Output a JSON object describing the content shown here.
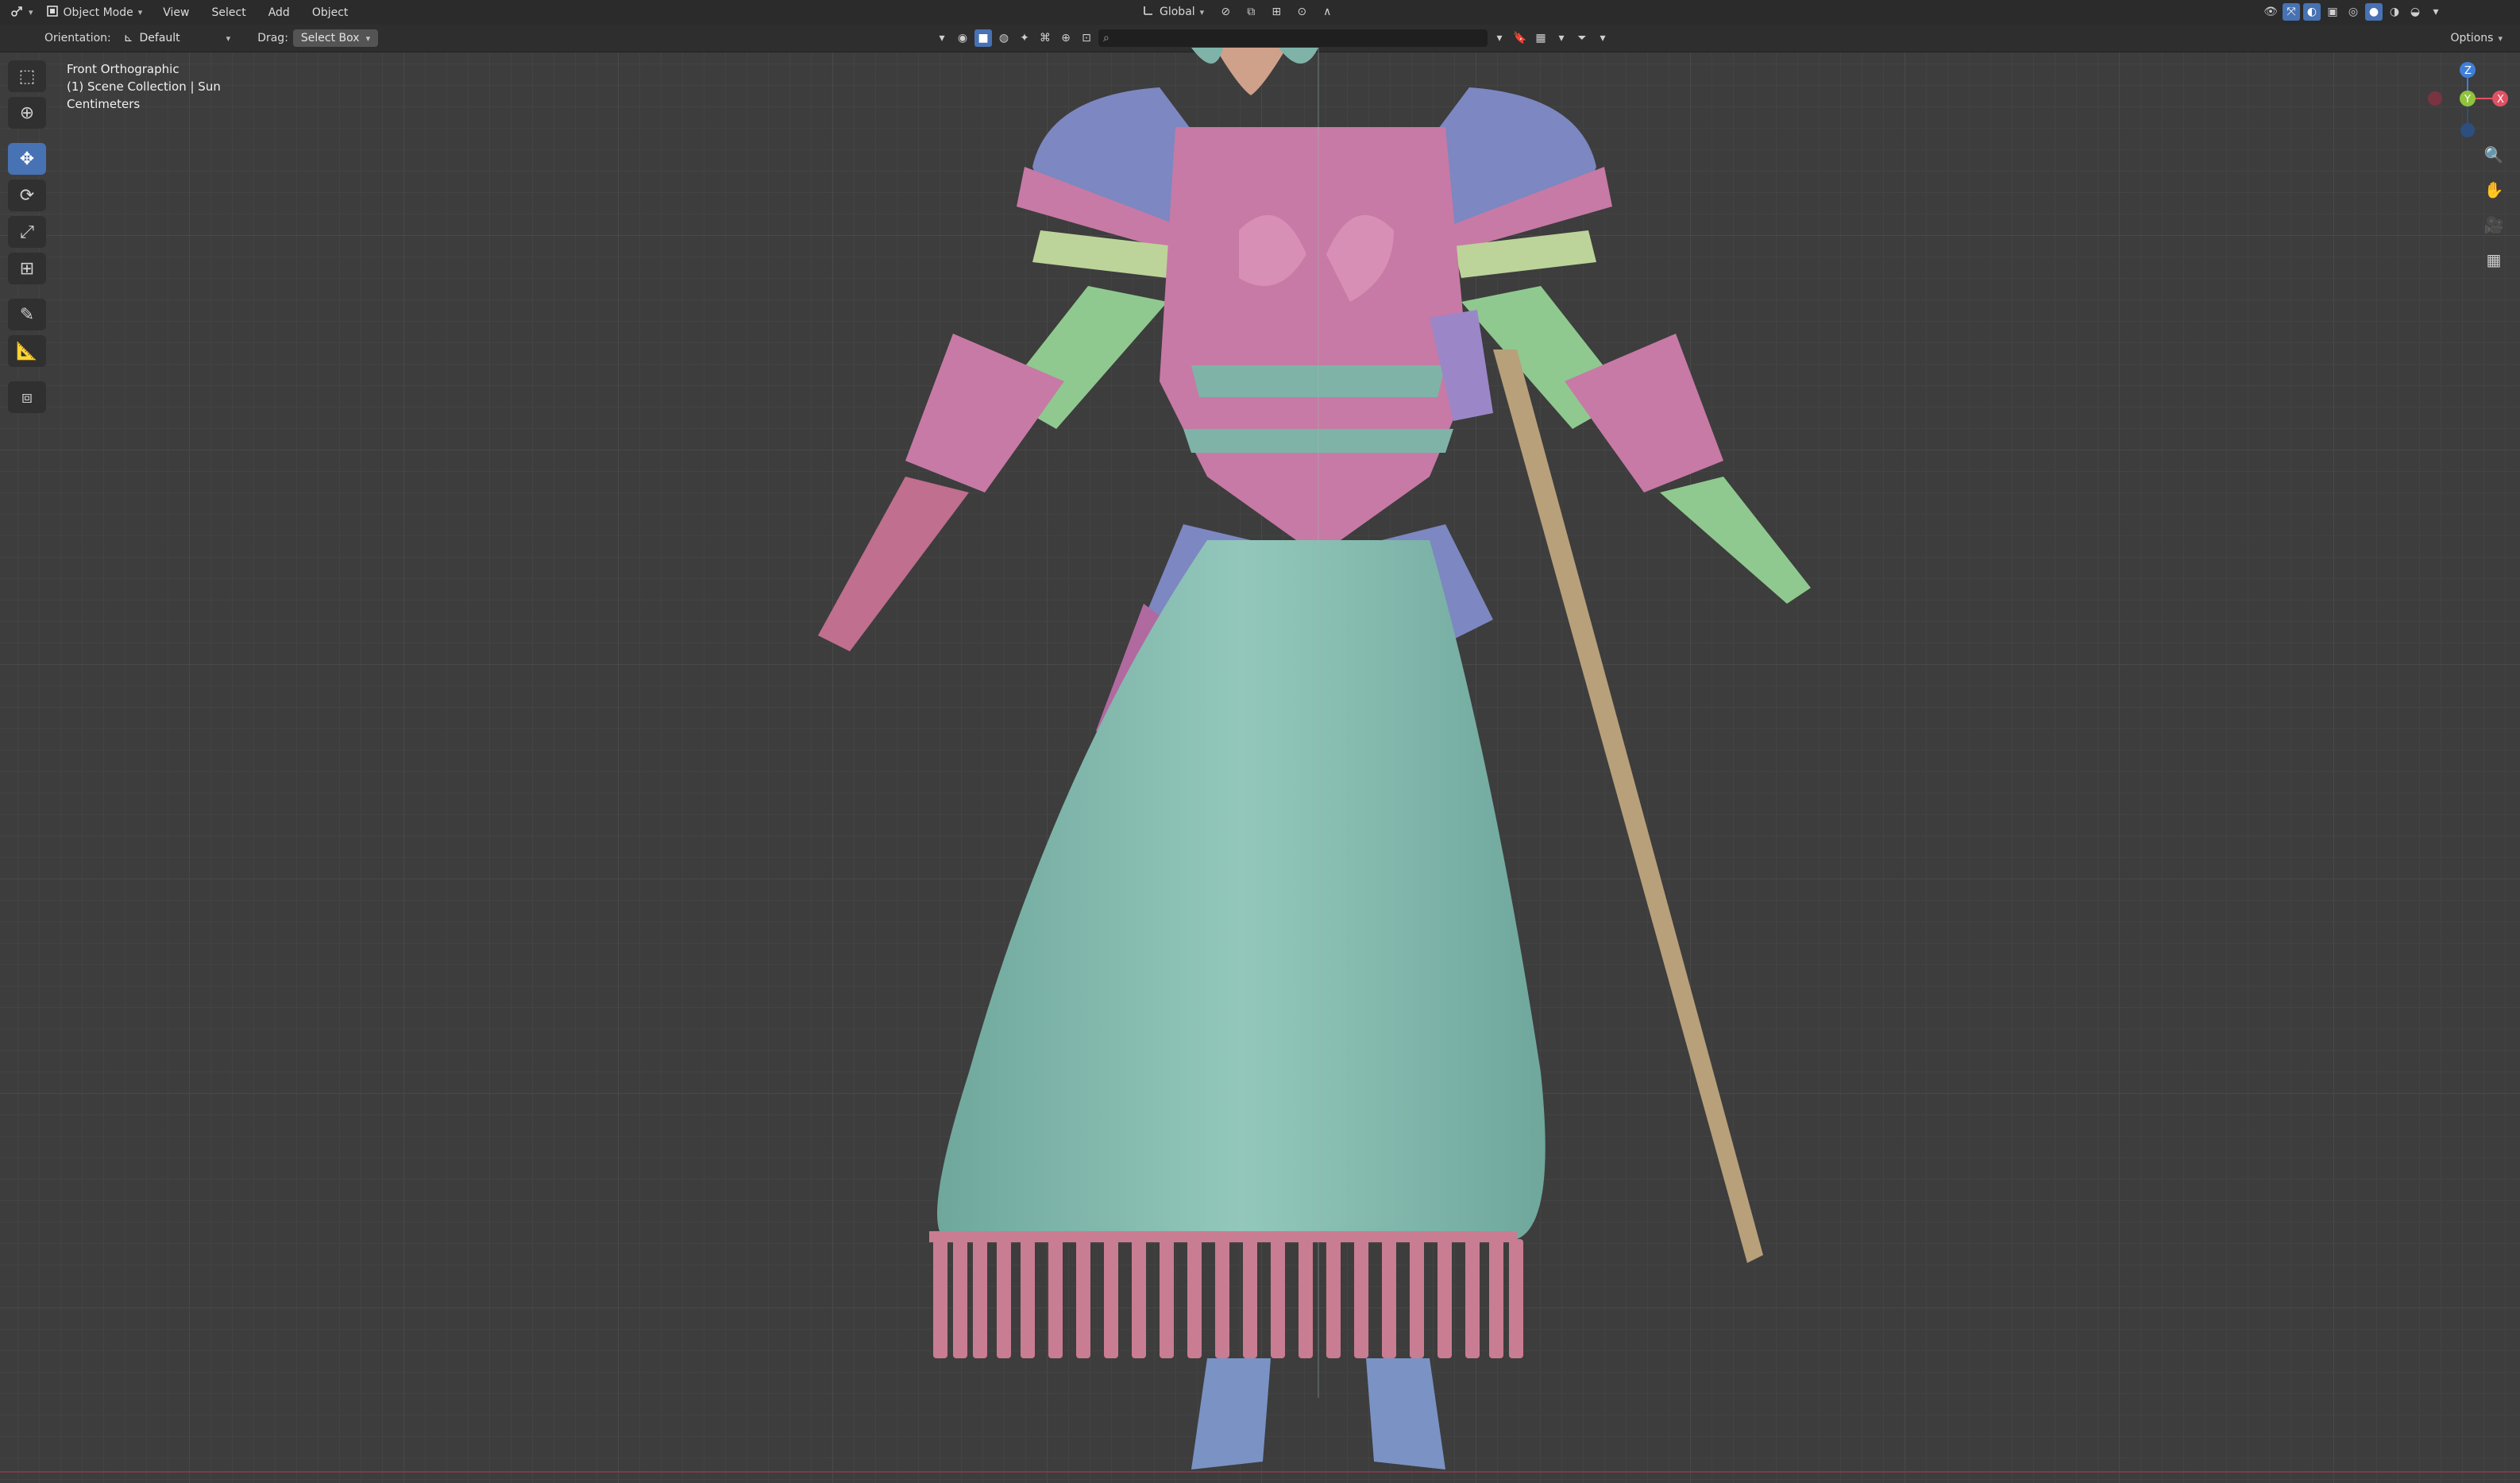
{
  "header": {
    "editor_type_icon": "3d-viewport-icon",
    "mode_label": "Object Mode",
    "menus": [
      "View",
      "Select",
      "Add",
      "Object"
    ],
    "transform_orientation": "Global",
    "options_label": "Options"
  },
  "tool_settings": {
    "orientation_label": "Orientation:",
    "orientation_value": "Default",
    "drag_label": "Drag:",
    "drag_value": "Select Box"
  },
  "viewport_info": {
    "view_name": "Front Orthographic",
    "collection": "(1) Scene Collection | Sun",
    "units": "Centimeters"
  },
  "toolbar": {
    "tools": [
      "select-box-icon",
      "cursor-icon",
      "move-icon",
      "rotate-icon",
      "scale-icon",
      "transform-icon",
      "annotate-icon",
      "measure-icon",
      "add-cube-icon"
    ],
    "active_tool": "move-icon"
  },
  "gizmo": {
    "axes": [
      "Z",
      "Y",
      "X"
    ],
    "colors": {
      "x": "#e05263",
      "y": "#8fc43b",
      "z": "#3f7fd9"
    }
  },
  "colors": {
    "accent": "#4772b3",
    "skirt": "#7fb3a8",
    "armor_pink": "#c77aa5",
    "armor_blue": "#7d87c1",
    "armor_green": "#8fc98f",
    "fringe": "#c97d92",
    "sword": "#b8a07a"
  }
}
